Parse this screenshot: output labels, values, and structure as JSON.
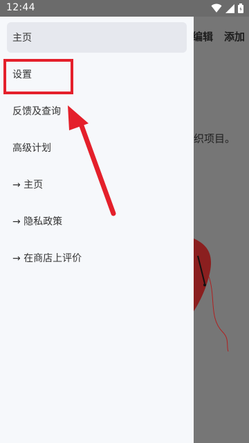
{
  "status_bar": {
    "time": "12:44",
    "icons": [
      "wifi-icon",
      "cell-signal-icon",
      "battery-icon"
    ]
  },
  "background_app": {
    "edit_label": "编辑",
    "add_label": "添加",
    "partial_text": "织项目。"
  },
  "drawer": {
    "items": [
      {
        "label": "主页",
        "active": true
      },
      {
        "label": "设置",
        "active": false
      },
      {
        "label": "反馈及查询",
        "active": false
      },
      {
        "label": "高级计划",
        "active": false
      },
      {
        "label": "→ 主页",
        "active": false
      },
      {
        "label": "→ 隐私政策",
        "active": false
      },
      {
        "label": "→ 在商店上评价",
        "active": false
      }
    ]
  },
  "colors": {
    "annotation_red": "#e4202b",
    "drawer_bg": "#f6f8fb",
    "active_item_bg": "#e6e8ee"
  }
}
